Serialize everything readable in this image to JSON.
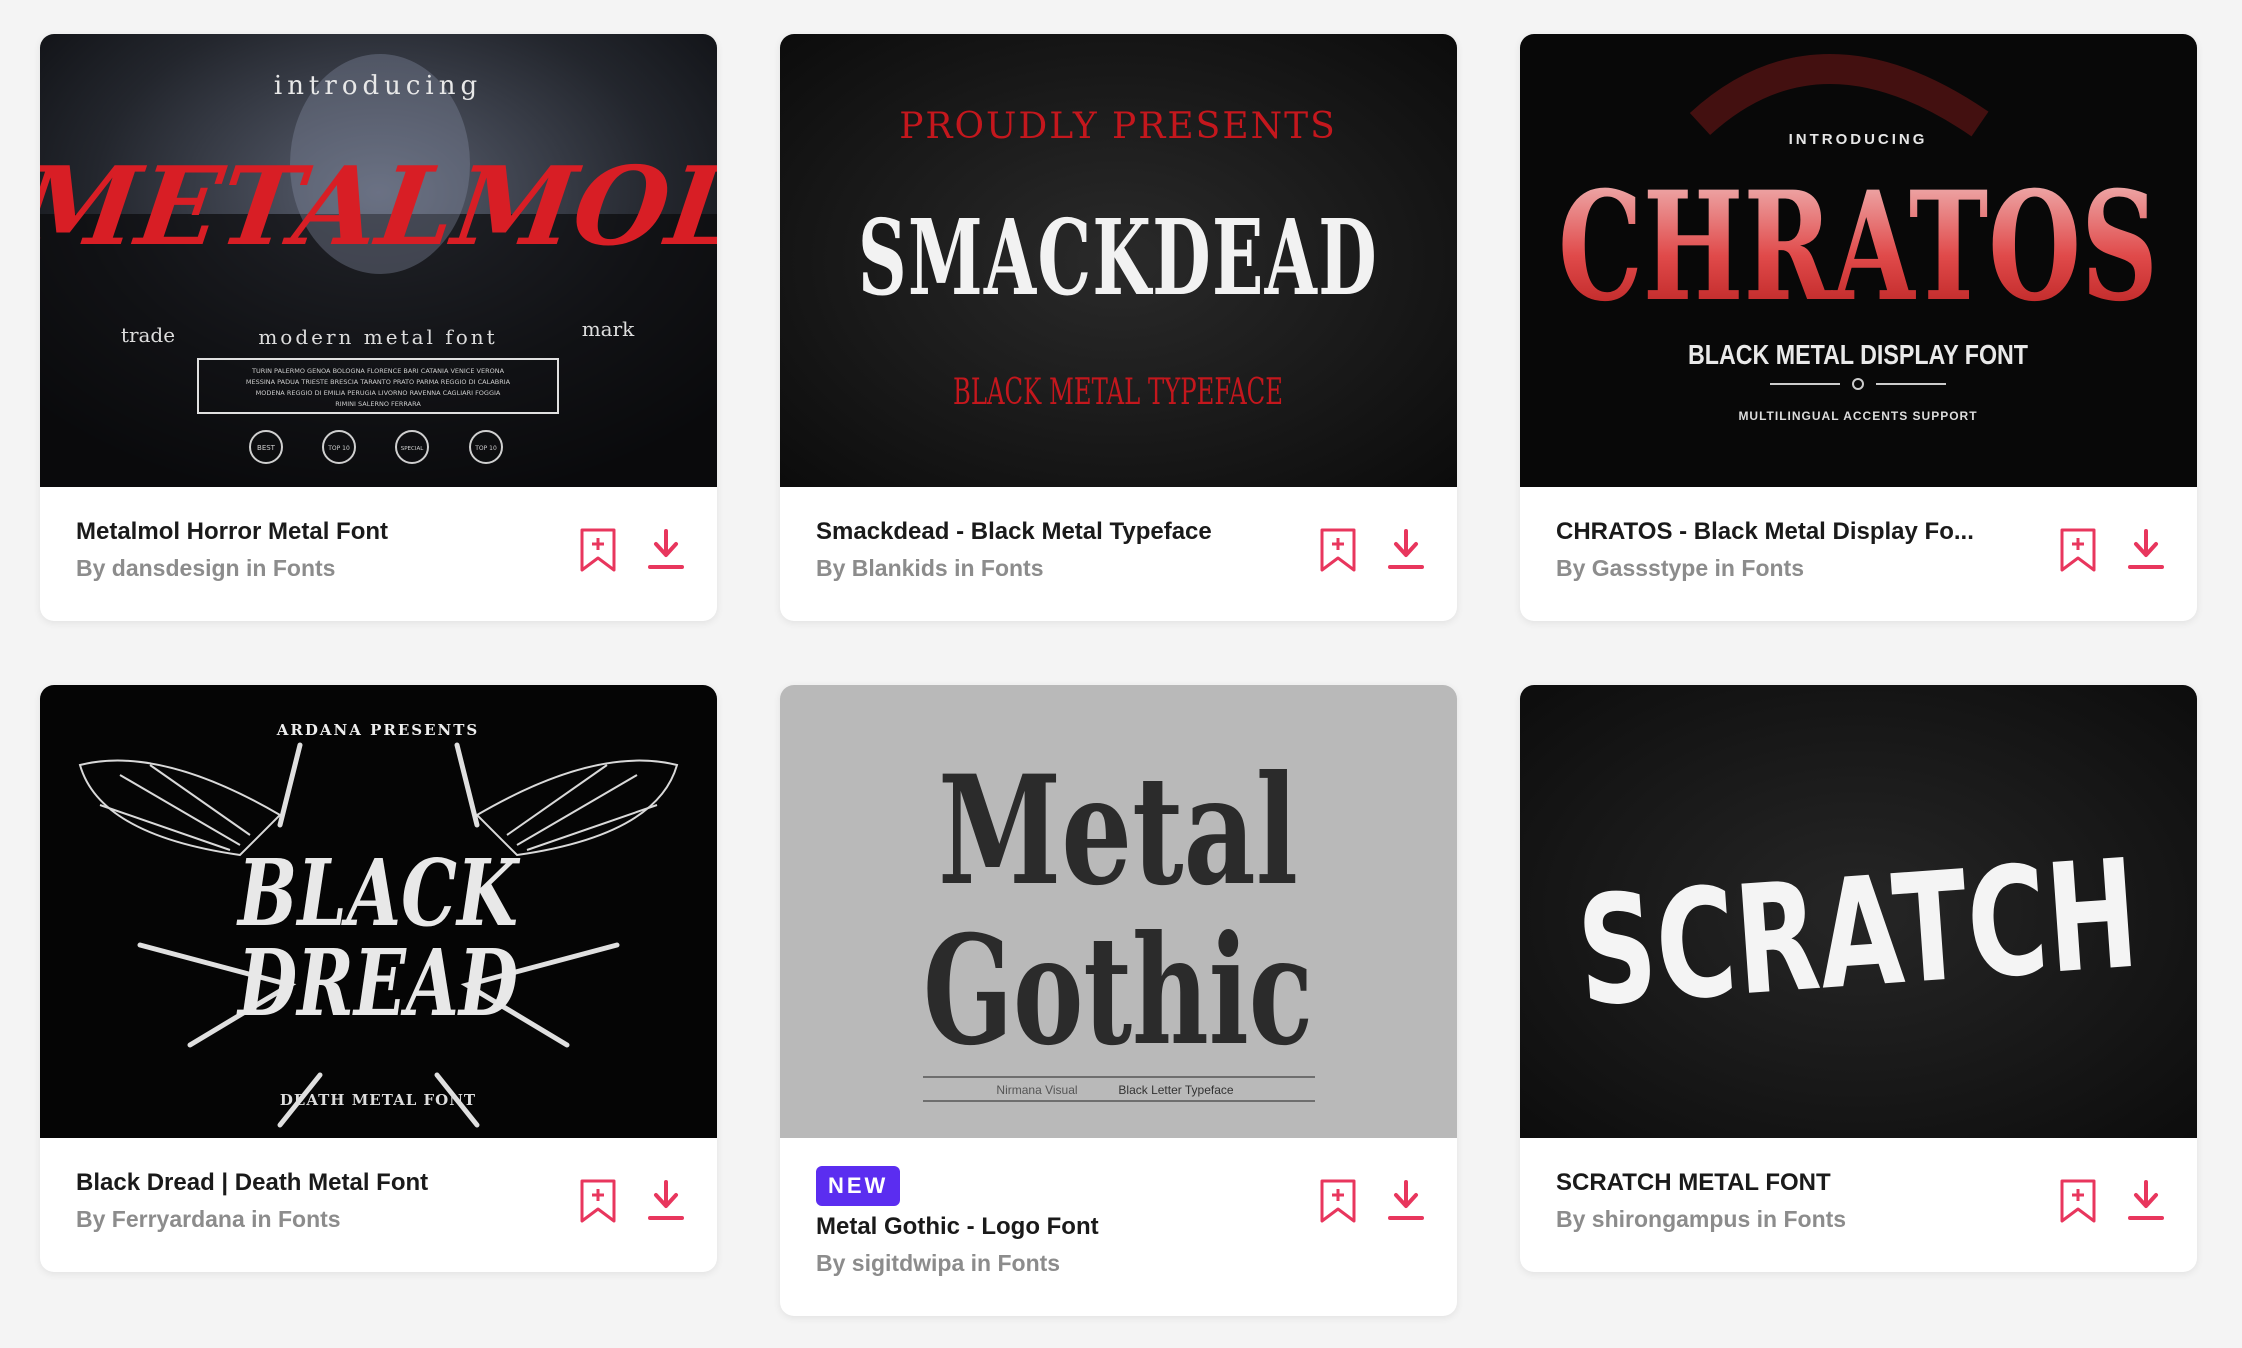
{
  "colors": {
    "accent": "#e8365d",
    "badge": "#5b2df0"
  },
  "cards": [
    {
      "title": "Metalmol Horror Metal Font",
      "by_prefix": "By",
      "author": "dansdesign",
      "in_word": "in",
      "category": "Fonts",
      "thumb": {
        "top": "introducing",
        "name": "METALMOL",
        "left": "trade",
        "sub": "modern metal font",
        "right": "mark",
        "box1": "TURIN PALERMO GENOA BOLOGNA FLORENCE BARI CATANIA VENICE VERONA",
        "box2": "MESSINA PADUA TRIESTE BRESCIA TARANTO PRATO PARMA REGGIO DI CALABRIA",
        "box3": "MODENA REGGIO DI EMILIA PERUGIA LIVORNO RAVENNA CAGLIARI FOGGIA",
        "box4": "RIMINI SALERNO FERRARA",
        "award1": "BEST",
        "award2": "TOP 10",
        "award3": "SPECIAL",
        "award4": "TOP 10"
      }
    },
    {
      "title": "Smackdead - Black Metal Typeface",
      "by_prefix": "By",
      "author": "Blankids",
      "in_word": "in",
      "category": "Fonts",
      "thumb": {
        "top": "PROUDLY PRESENTS",
        "name": "SMACKDEAD",
        "sub": "BLACK METAL TYPEFACE"
      }
    },
    {
      "title": "CHRATOS - Black Metal Display Fo...",
      "by_prefix": "By",
      "author": "Gassstype",
      "in_word": "in",
      "category": "Fonts",
      "thumb": {
        "top": "INTRODUCING",
        "name": "CHRATOS",
        "sub": "BLACK METAL DISPLAY FONT",
        "foot": "MULTILINGUAL ACCENTS SUPPORT"
      }
    },
    {
      "title": "Black Dread | Death Metal Font",
      "by_prefix": "By",
      "author": "Ferryardana",
      "in_word": "in",
      "category": "Fonts",
      "thumb": {
        "top": "ARDANA PRESENTS",
        "name1": "BLACK",
        "name2": "DREAD",
        "sub": "DEATH METAL FONT"
      }
    },
    {
      "badge": "NEW",
      "title": "Metal Gothic - Logo Font",
      "by_prefix": "By",
      "author": "sigitdwipa",
      "in_word": "in",
      "category": "Fonts",
      "thumb": {
        "name1": "Metal",
        "name2": "Gothic",
        "left": "Nirmana Visual",
        "right": "Black Letter Typeface"
      }
    },
    {
      "title": "SCRATCH METAL FONT",
      "by_prefix": "By",
      "author": "shirongampus",
      "in_word": "in",
      "category": "Fonts",
      "thumb": {
        "name": "SCRATCH"
      }
    }
  ],
  "icons": {
    "bookmark": "bookmark-add-icon",
    "download": "download-icon"
  }
}
